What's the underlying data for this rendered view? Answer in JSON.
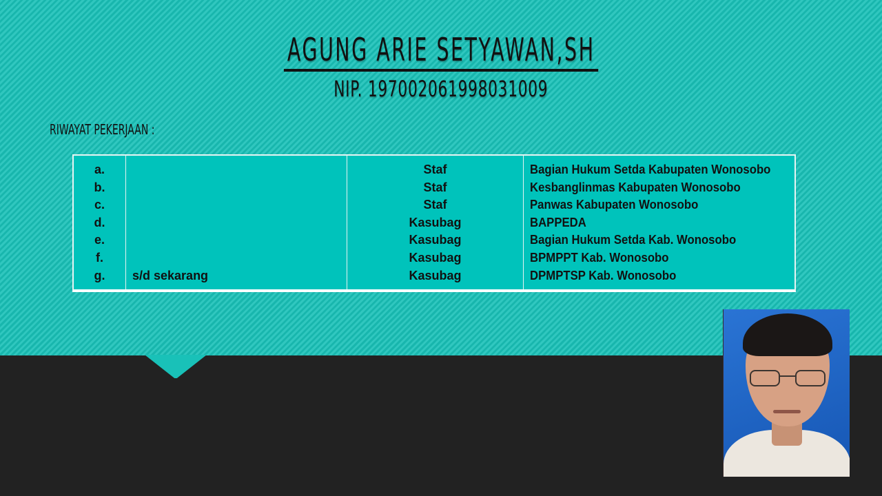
{
  "header": {
    "name": "AGUNG ARIE SETYAWAN,SH",
    "nip": "NIP. 197002061998031009"
  },
  "section_label": "RIWAYAT PEKERJAAN :",
  "table": {
    "letters": [
      "a.",
      "b.",
      "c.",
      "d.",
      "e.",
      "f.",
      "g."
    ],
    "period_note": "s/d sekarang",
    "roles": [
      "Staf",
      "Staf",
      "Staf",
      "Kasubag",
      "Kasubag",
      "Kasubag",
      "Kasubag"
    ],
    "organizations": [
      "Bagian Hukum Setda Kabupaten Wonosobo",
      "Kesbanglinmas Kabupaten Wonosobo",
      "Panwas Kabupaten Wonosobo",
      "BAPPEDA",
      "Bagian Hukum Setda Kab. Wonosobo",
      "BPMPPT  Kab. Wonosobo",
      "DPMPTSP  Kab. Wonosobo"
    ]
  },
  "colors": {
    "teal_background": "#19c1b8",
    "table_fill": "#00c3bb",
    "dark_background": "#222222",
    "photo_background": "#1d63c6"
  },
  "photo": {
    "subject": "portrait-photo"
  }
}
